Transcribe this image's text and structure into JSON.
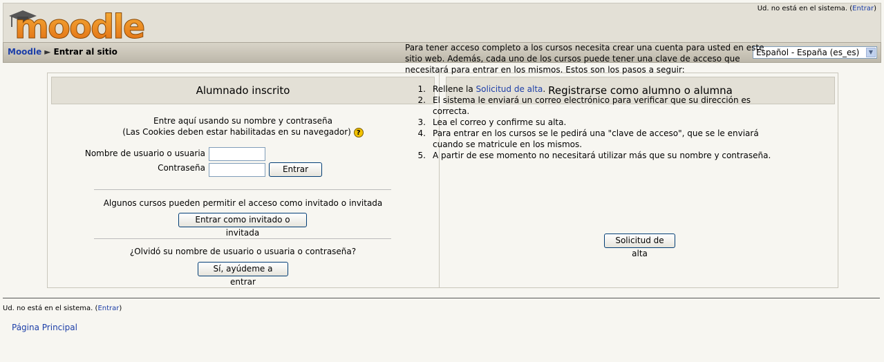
{
  "header": {
    "logo_text": "moodle",
    "login_info_prefix": "Ud. no está en el sistema. (",
    "login_link": "Entrar",
    "login_info_suffix": ")"
  },
  "navbar": {
    "home_link": "Moodle",
    "separator": "►",
    "current": "Entrar al sitio",
    "language_selected": "Español - España (es_es)"
  },
  "login": {
    "title": "Alumnado inscrito",
    "intro_line1": "Entre aquí usando su nombre y contraseña",
    "intro_line2": "(Las Cookies deben estar habilitadas en su navegador)",
    "username_label": "Nombre de usuario o usuaria",
    "password_label": "Contraseña",
    "username_value": "",
    "password_value": "",
    "submit_label": "Entrar",
    "guest_text": "Algunos cursos pueden permitir el acceso como invitado o invitada",
    "guest_button": "Entrar como invitado o invitada",
    "forgot_text": "¿Olvidó su nombre de usuario o usuaria o contraseña?",
    "forgot_button": "Sí, ayúdeme a entrar"
  },
  "signup": {
    "title": "Registrarse como alumno o alumna",
    "intro": "Para tener acceso completo a los cursos necesita crear una cuenta para usted en este sitio web. Además, cada uno de los cursos puede tener una clave de acceso que necesitará para entrar en los mismos. Estos son los pasos a seguir:",
    "steps": [
      {
        "num": "1.",
        "pre": "Rellene la ",
        "link": "Solicitud de alta",
        "post": "."
      },
      {
        "num": "2.",
        "pre": "El sistema le enviará un correo electrónico para verificar que su dirección es correcta.",
        "link": "",
        "post": ""
      },
      {
        "num": "3.",
        "pre": "Lea el correo y confirme su alta.",
        "link": "",
        "post": ""
      },
      {
        "num": "4.",
        "pre": "Para entrar en los cursos se le pedirá una \"clave de acceso\", que se le enviará cuando se matricule en los mismos.",
        "link": "",
        "post": ""
      },
      {
        "num": "5.",
        "pre": "A partir de ese momento no necesitará utilizar más que su nombre y contraseña.",
        "link": "",
        "post": ""
      }
    ],
    "button": "Solicitud de alta"
  },
  "footer": {
    "login_info_prefix": "Ud. no está en el sistema. (",
    "login_link": "Entrar",
    "login_info_suffix": ")",
    "home_link": "Página Principal"
  },
  "icons": {
    "help": "help-icon",
    "mortarboard": "mortarboard-icon",
    "dropdown": "chevron-down-icon"
  }
}
